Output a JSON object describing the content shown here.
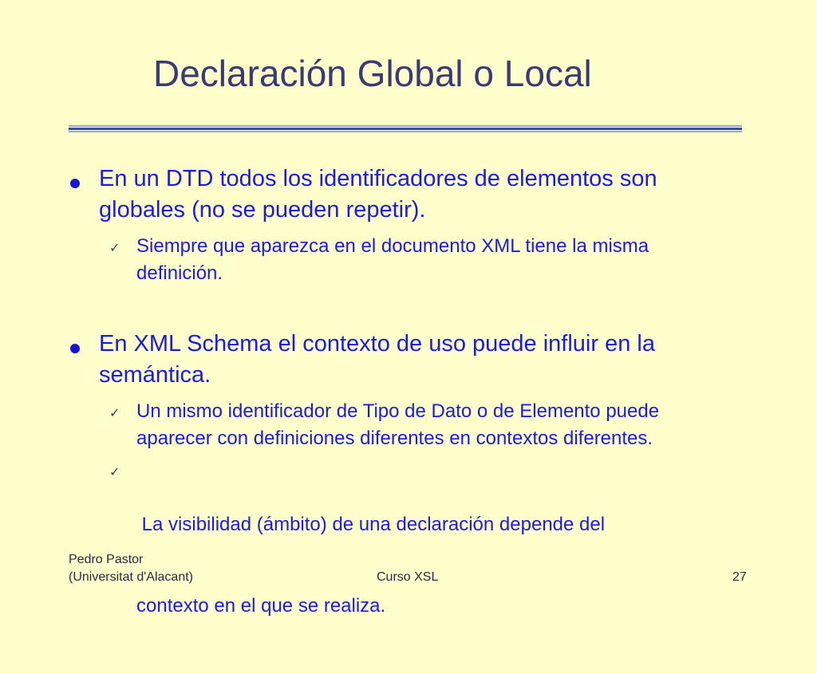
{
  "slide": {
    "title": "Declaración Global o Local",
    "points": [
      {
        "text_line1": "En un DTD todos los identificadores de elementos son",
        "text_line2": "globales (no se pueden repetir).",
        "subpoints": [
          {
            "text_line1": "Siempre que aparezca en el documento XML tiene la misma",
            "text_line2": "definición."
          }
        ]
      },
      {
        "text_line1": "En XML Schema el contexto de uso puede influir en la",
        "text_line2": "semántica.",
        "subpoints": [
          {
            "text_line1": "Un mismo identificador de Tipo de Dato o de Elemento puede",
            "text_line2": "aparecer con definiciones diferentes en contextos diferentes."
          },
          {
            "text_line1": " La visibilidad (ámbito) de una declaración depende del",
            "text_line2": "contexto en el que se realiza."
          }
        ]
      }
    ],
    "check_glyph": "✓",
    "footer": {
      "author": "Pedro Pastor",
      "institution": "(Universitat d'Alacant)",
      "course": "Curso XSL",
      "page_number": "27"
    }
  },
  "colors": {
    "background": "#ffffcc",
    "title": "#3a3a78",
    "body_text": "#1a1aee",
    "rule": "#3c4bb0"
  },
  "icons": {
    "bullet": "filled-circle-bullet-icon",
    "subbullet": "checkmark-icon"
  }
}
